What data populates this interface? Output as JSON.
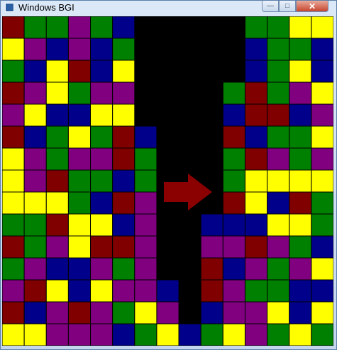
{
  "window": {
    "title": "Windows BGI",
    "icons": {
      "app": "app-icon",
      "minimize": "minimize-icon",
      "maximize": "maximize-icon",
      "close": "close-icon"
    }
  },
  "palette": {
    "R": "#800000",
    "G": "#008000",
    "U": "#00008b",
    "P": "#800080",
    "Y": "#ffff00",
    "K": "#000000"
  },
  "arrow": {
    "icon": "right-arrow-icon",
    "color": "#8b0000"
  },
  "board": {
    "rows": [
      "RGGPGUKKKKKGGYY",
      "YPUPUGKKKKKUGGU",
      "GUYRUYKKKKKUGYU",
      "RPYGPPKKKKGRGPY",
      "PYUUYYKKKKURRUP",
      "RUGYGRUKKKRUGGY",
      "YPGPPRGKKKGRPGP",
      "YPRGGUGKKKGYYYY",
      "YYYGURPKKKRYURG",
      "GGRYYUPKKUUUYYG",
      "RGPYRRPKKPPRPGU",
      "GPUUPGPKKRUPGPY",
      "PRYUYPPUKRPGGUU",
      "RUPRPGYPKUPPYUY",
      "YYPPPUGYUGYPGYG"
    ]
  }
}
